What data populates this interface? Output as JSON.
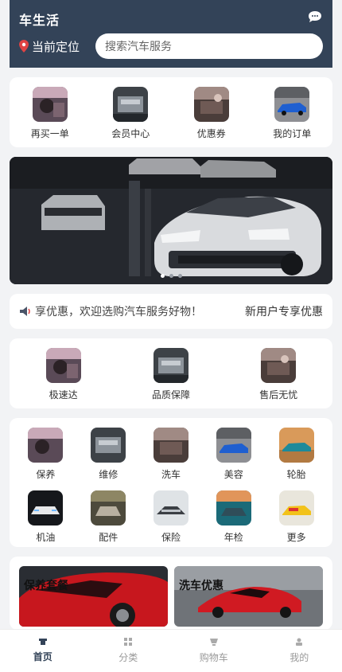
{
  "header": {
    "title": "车生活",
    "chat_icon": "chat-bubble-icon",
    "location_label": "当前定位",
    "search_placeholder": "搜索汽车服务"
  },
  "quick_links": [
    {
      "label": "再买一单",
      "icon": "car-interior-photo"
    },
    {
      "label": "会员中心",
      "icon": "engine-photo"
    },
    {
      "label": "优惠券",
      "icon": "car-repair-photo"
    },
    {
      "label": "我的订单",
      "icon": "blue-sports-car-photo"
    }
  ],
  "banner": {
    "slides": 3,
    "active_slide": 1
  },
  "notice": {
    "text": "享优惠，欢迎选购汽车服务好物！",
    "link": "新用户专享优惠"
  },
  "features": [
    {
      "label": "极速达"
    },
    {
      "label": "品质保障"
    },
    {
      "label": "售后无忧"
    }
  ],
  "services": [
    {
      "label": "保养"
    },
    {
      "label": "维修"
    },
    {
      "label": "洗车"
    },
    {
      "label": "美容"
    },
    {
      "label": "轮胎"
    },
    {
      "label": "机油"
    },
    {
      "label": "配件"
    },
    {
      "label": "保险"
    },
    {
      "label": "年检"
    },
    {
      "label": "更多"
    }
  ],
  "promos": [
    {
      "title": "保养套餐"
    },
    {
      "title": "洗车优惠"
    }
  ],
  "tabbar": [
    {
      "label": "首页",
      "icon": "home-icon",
      "active": true
    },
    {
      "label": "分类",
      "icon": "grid-icon",
      "active": false
    },
    {
      "label": "购物车",
      "icon": "cart-icon",
      "active": false
    },
    {
      "label": "我的",
      "icon": "user-icon",
      "active": false
    }
  ],
  "colors": {
    "header_bg": "#334358",
    "accent": "#334358",
    "page_bg": "#f2f3f5"
  }
}
